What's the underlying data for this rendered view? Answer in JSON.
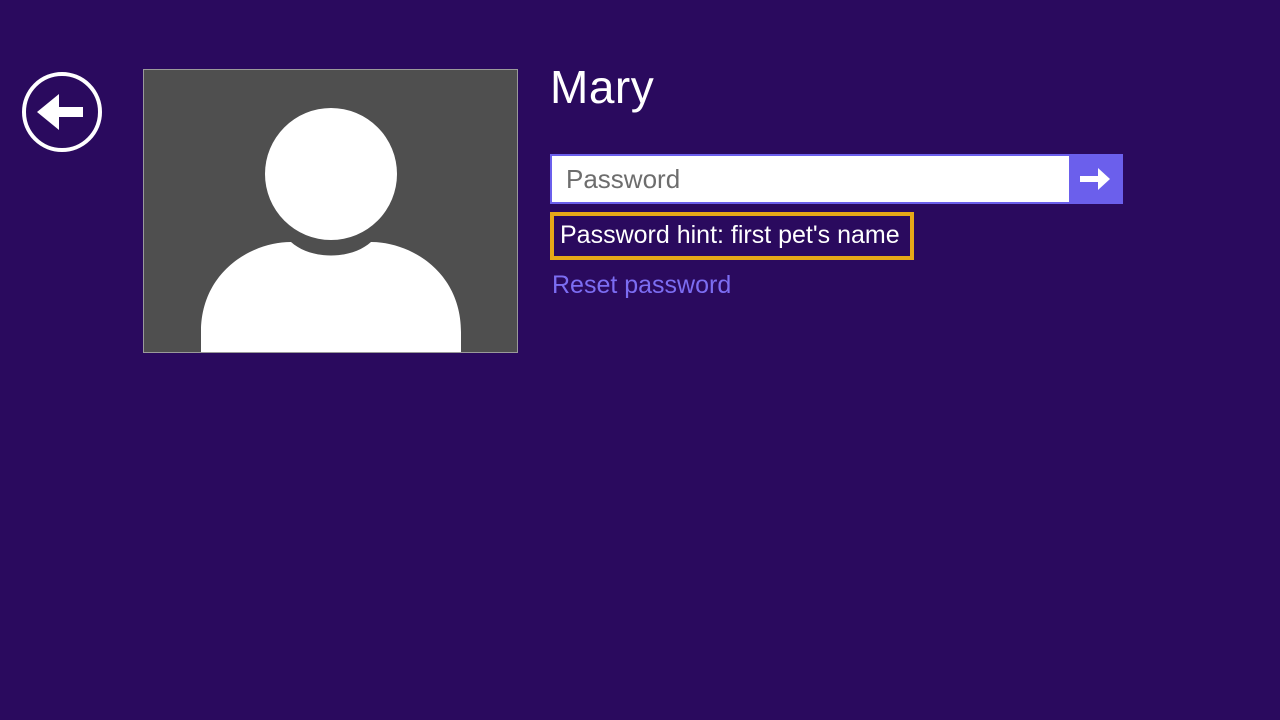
{
  "user": {
    "name": "Mary"
  },
  "password": {
    "placeholder": "Password",
    "value": "",
    "hint": "Password hint: first pet's name"
  },
  "links": {
    "reset": "Reset password"
  },
  "colors": {
    "background": "#2a0a5e",
    "accent": "#6b5fec",
    "highlight_border": "#e6a817",
    "link": "#7c6df2",
    "avatar_bg": "#4f4f4f"
  },
  "icons": {
    "back": "back-arrow-icon",
    "submit": "arrow-right-icon",
    "avatar": "user-silhouette-icon"
  }
}
